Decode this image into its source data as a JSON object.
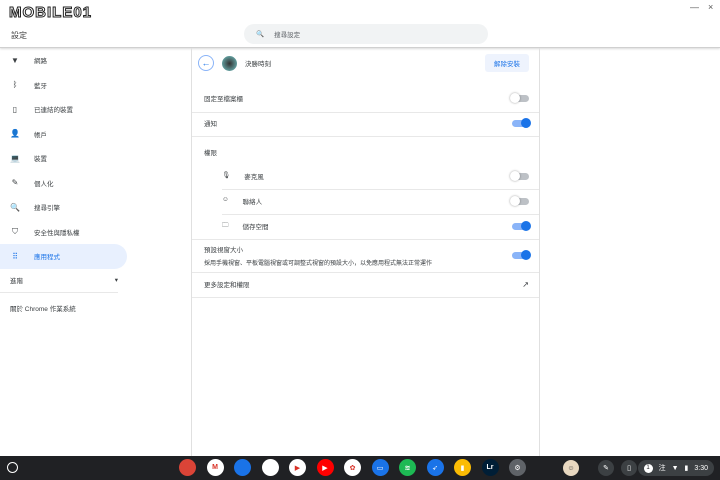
{
  "header": {
    "logo": "MOBILE01",
    "title": "設定",
    "search_placeholder": "搜尋設定",
    "minimize": "—",
    "close": "×"
  },
  "sidebar": {
    "items": [
      {
        "label": "網路",
        "icon": "wifi-icon",
        "glyph": "▼"
      },
      {
        "label": "藍牙",
        "icon": "bluetooth-icon",
        "glyph": "ᛒ"
      },
      {
        "label": "已連結的裝置",
        "icon": "phone-icon",
        "glyph": "▯"
      },
      {
        "label": "帳戶",
        "icon": "person-icon",
        "glyph": "👤"
      },
      {
        "label": "裝置",
        "icon": "laptop-icon",
        "glyph": "💻"
      },
      {
        "label": "個人化",
        "icon": "brush-icon",
        "glyph": "✎"
      },
      {
        "label": "搜尋引擎",
        "icon": "search-icon",
        "glyph": "🔍"
      },
      {
        "label": "安全性與隱私權",
        "icon": "shield-icon",
        "glyph": "⛉"
      },
      {
        "label": "應用程式",
        "icon": "apps-grid-icon",
        "glyph": "⠿"
      }
    ],
    "advanced": "進階",
    "about": "關於 Chrome 作業系統"
  },
  "app": {
    "name": "決勝時刻",
    "uninstall": "解除安裝",
    "pin_shelf": "固定至檔案櫃",
    "pin_shelf_on": false,
    "notifications": "通知",
    "notifications_on": true,
    "permissions": "權限",
    "perms": [
      {
        "label": "麥克風",
        "icon": "microphone-icon",
        "glyph": "🎙",
        "on": false
      },
      {
        "label": "聯絡人",
        "icon": "contacts-icon",
        "glyph": "☺",
        "on": false
      },
      {
        "label": "儲存空間",
        "icon": "folder-icon",
        "glyph": "🗀",
        "on": true
      }
    ],
    "window_size": "預設視窗大小",
    "window_size_desc": "採用手機視窗、平板電腦視窗或可調整式視窗的預設大小，以免應用程式無法正常運作",
    "window_size_on": true,
    "more": "更多設定和權限"
  },
  "taskbar": {
    "apps": [
      {
        "name": "chrome",
        "color": "#db4437",
        "t": ""
      },
      {
        "name": "gmail",
        "color": "#ffffff",
        "t": "M"
      },
      {
        "name": "files",
        "color": "#1a73e8",
        "t": ""
      },
      {
        "name": "meet",
        "color": "#ffffff",
        "t": ""
      },
      {
        "name": "play-store",
        "color": "#ffffff",
        "t": "▶"
      },
      {
        "name": "youtube",
        "color": "#ff0000",
        "t": "▶"
      },
      {
        "name": "photos",
        "color": "#ffffff",
        "t": "✿"
      },
      {
        "name": "screen",
        "color": "#1a73e8",
        "t": "▭"
      },
      {
        "name": "spotify",
        "color": "#1db954",
        "t": "≋"
      },
      {
        "name": "rocket",
        "color": "#1a73e8",
        "t": "➶"
      },
      {
        "name": "keep",
        "color": "#fbbc04",
        "t": "▮"
      },
      {
        "name": "lightroom",
        "color": "#001e36",
        "t": "Lr"
      },
      {
        "name": "settings",
        "color": "#5f6368",
        "t": "⚙"
      }
    ],
    "notif_count": "1",
    "ime": "注",
    "time": "3:30"
  }
}
